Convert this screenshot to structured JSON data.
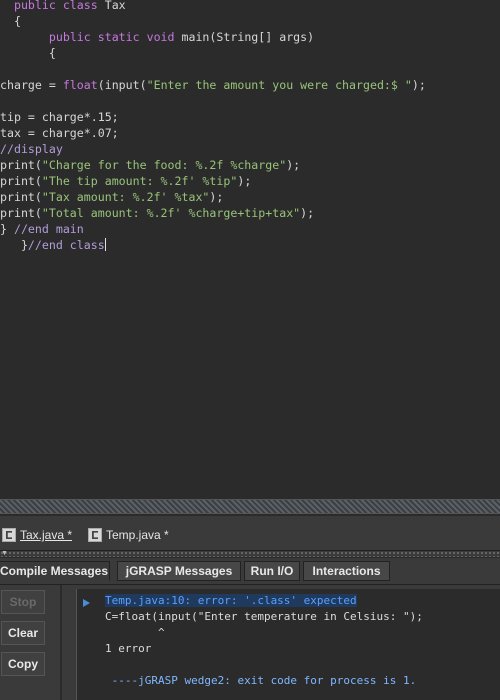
{
  "editor": {
    "lines": [
      {
        "segments": [
          {
            "t": "  ",
            "c": ""
          },
          {
            "t": "public class",
            "c": "k"
          },
          {
            "t": " Tax",
            "c": ""
          }
        ]
      },
      {
        "segments": [
          {
            "t": "  {",
            "c": ""
          }
        ]
      },
      {
        "segments": [
          {
            "t": "       ",
            "c": ""
          },
          {
            "t": "public static void",
            "c": "k"
          },
          {
            "t": " main(String[] args)",
            "c": ""
          }
        ]
      },
      {
        "segments": [
          {
            "t": "       {",
            "c": ""
          }
        ]
      },
      {
        "segments": [
          {
            "t": "",
            "c": ""
          }
        ]
      },
      {
        "segments": [
          {
            "t": "charge = ",
            "c": ""
          },
          {
            "t": "float",
            "c": "k"
          },
          {
            "t": "(input(",
            "c": ""
          },
          {
            "t": "\"Enter the amount you were charged:$ \"",
            "c": "s"
          },
          {
            "t": ");",
            "c": ""
          }
        ]
      },
      {
        "segments": [
          {
            "t": "",
            "c": ""
          }
        ]
      },
      {
        "segments": [
          {
            "t": "tip = charge*.15;",
            "c": ""
          }
        ]
      },
      {
        "segments": [
          {
            "t": "tax = charge*.07;",
            "c": ""
          }
        ]
      },
      {
        "segments": [
          {
            "t": "//display",
            "c": "c"
          }
        ]
      },
      {
        "segments": [
          {
            "t": "print(",
            "c": ""
          },
          {
            "t": "\"Charge for the food: %.2f %charge\"",
            "c": "s"
          },
          {
            "t": ");",
            "c": ""
          }
        ]
      },
      {
        "segments": [
          {
            "t": "print(",
            "c": ""
          },
          {
            "t": "\"The tip amount: %.2f' %tip\"",
            "c": "s"
          },
          {
            "t": ");",
            "c": ""
          }
        ]
      },
      {
        "segments": [
          {
            "t": "print(",
            "c": ""
          },
          {
            "t": "\"Tax amount: %.2f' %tax\"",
            "c": "s"
          },
          {
            "t": ");",
            "c": ""
          }
        ]
      },
      {
        "segments": [
          {
            "t": "print(",
            "c": ""
          },
          {
            "t": "\"Total amount: %.2f' %charge+tip+tax\"",
            "c": "s"
          },
          {
            "t": ");",
            "c": ""
          }
        ]
      },
      {
        "segments": [
          {
            "t": "} ",
            "c": ""
          },
          {
            "t": "//end main",
            "c": "c"
          }
        ]
      },
      {
        "segments": [
          {
            "t": "   }",
            "c": ""
          },
          {
            "t": "//end class",
            "c": "c"
          }
        ],
        "cursor": true
      }
    ]
  },
  "file_tabs": [
    {
      "label": "Tax.java *",
      "active": true
    },
    {
      "label": "Temp.java *",
      "active": false
    }
  ],
  "message_tabs": [
    {
      "label": "Compile Messages",
      "active": true
    },
    {
      "label": "jGRASP Messages",
      "active": false
    },
    {
      "label": "Run I/O",
      "active": false
    },
    {
      "label": "Interactions",
      "active": false
    }
  ],
  "buttons": {
    "stop": "Stop",
    "clear": "Clear",
    "copy": "Copy"
  },
  "messages": {
    "error_line": "Temp.java:10: error: '.class' expected",
    "code_line": "C=float(input(\"Enter temperature in Celsius: \");",
    "caret_line": "        ^",
    "count_line": "1 error",
    "blank": "",
    "exit_line": " ----jGRASP wedge2: exit code for process is 1."
  }
}
